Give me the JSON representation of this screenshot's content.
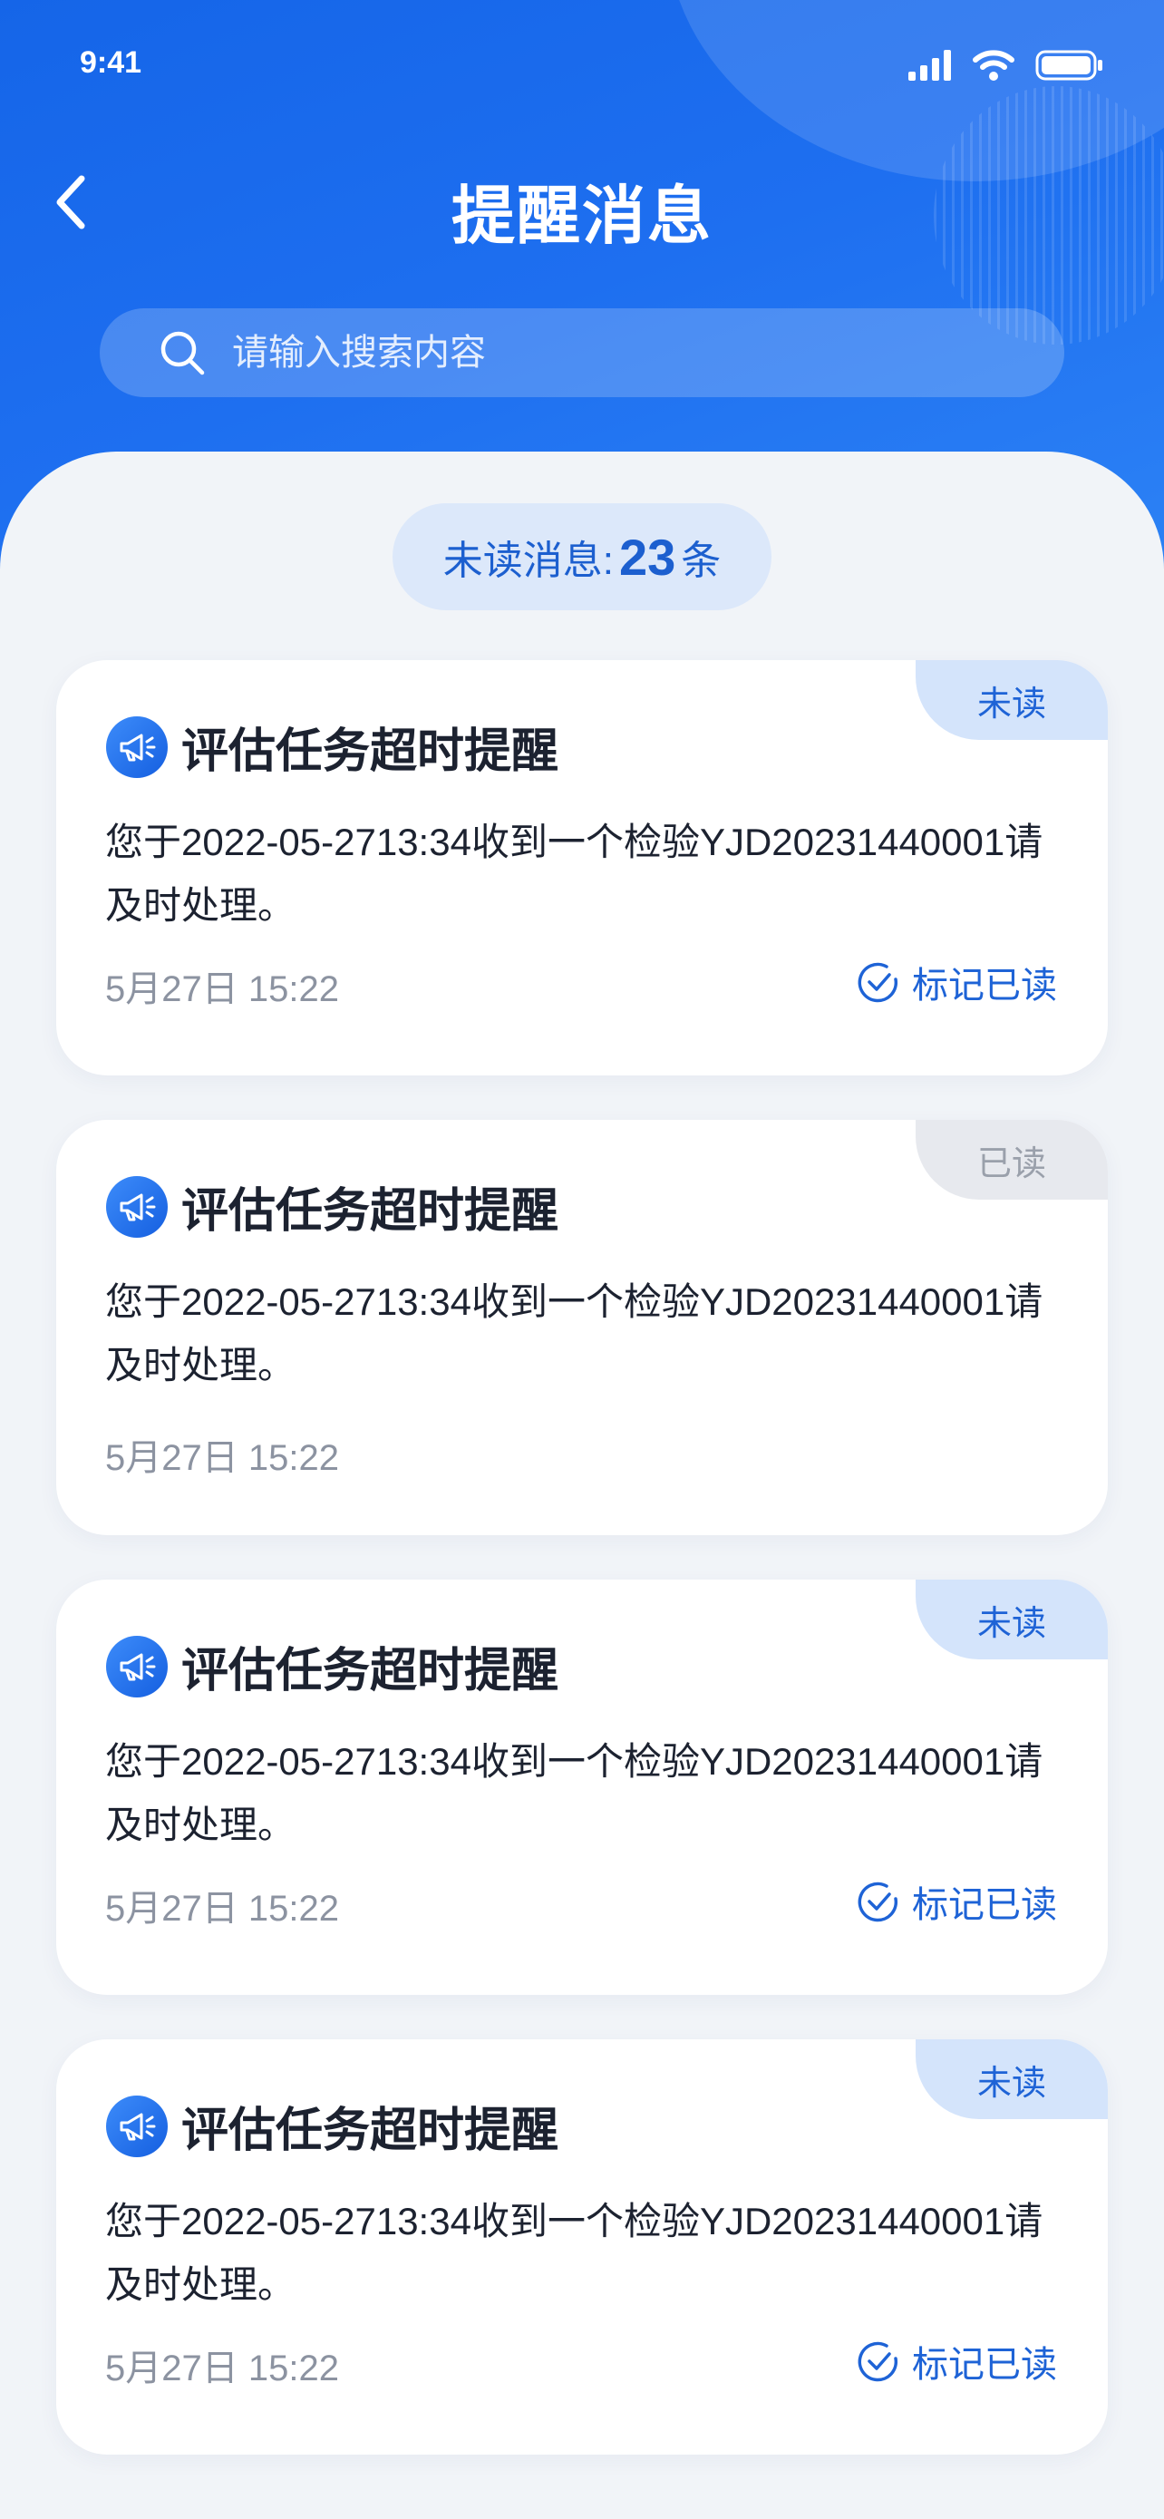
{
  "status_bar": {
    "time": "9:41"
  },
  "header": {
    "title": "提醒消息",
    "search_placeholder": "请输入搜索内容"
  },
  "unread_summary": {
    "label": "未读消息:",
    "count": "23",
    "unit": "条"
  },
  "messages": [
    {
      "status": "未读",
      "title": "评估任务超时提醒",
      "body": "您于2022-05-2713:34收到一个检验YJD20231440001请及时处理。",
      "time": "5月27日 15:22",
      "action": "标记已读"
    },
    {
      "status": "已读",
      "title": "评估任务超时提醒",
      "body": "您于2022-05-2713:34收到一个检验YJD20231440001请及时处理。",
      "time": "5月27日 15:22"
    },
    {
      "status": "未读",
      "title": "评估任务超时提醒",
      "body": "您于2022-05-2713:34收到一个检验YJD20231440001请及时处理。",
      "time": "5月27日 15:22",
      "action": "标记已读"
    },
    {
      "status": "未读",
      "title": "评估任务超时提醒",
      "body": "您于2022-05-2713:34收到一个检验YJD20231440001请及时处理。",
      "time": "5月27日 15:22",
      "action": "标记已读"
    }
  ],
  "colors": {
    "primary": "#1E6FF0",
    "unread_badge": "#D4E4FB",
    "read_badge": "#E7E9EE"
  },
  "icons": {
    "back": "chevron-left-icon",
    "search": "search-icon",
    "message": "megaphone-icon",
    "mark_read": "check-circle-icon"
  }
}
